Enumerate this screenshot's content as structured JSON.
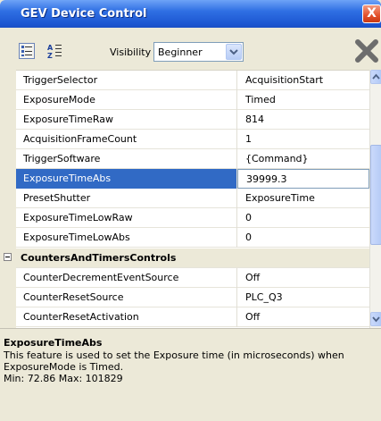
{
  "window": {
    "title": "GEV Device Control",
    "close_glyph": "X"
  },
  "toolbar": {
    "categorized_view_icon": "categorized-view-icon",
    "sort_alpha_icon": "sort-az-icon",
    "visibility_label": "Visibility",
    "visibility_value": "Beginner",
    "delete_icon": "x-icon"
  },
  "grid": {
    "rows": [
      {
        "name": "TriggerSelector",
        "value": "AcquisitionStart"
      },
      {
        "name": "ExposureMode",
        "value": "Timed"
      },
      {
        "name": "ExposureTimeRaw",
        "value": "814"
      },
      {
        "name": "AcquisitionFrameCount",
        "value": "1"
      },
      {
        "name": "TriggerSoftware",
        "value": "{Command}"
      },
      {
        "name": "ExposureTimeAbs",
        "value": "39999.3"
      },
      {
        "name": "PresetShutter",
        "value": "ExposureTime"
      },
      {
        "name": "ExposureTimeLowRaw",
        "value": "0"
      },
      {
        "name": "ExposureTimeLowAbs",
        "value": "0"
      }
    ],
    "category": {
      "label": "CountersAndTimersControls",
      "toggle": "−"
    },
    "category_rows": [
      {
        "name": "CounterDecrementEventSource",
        "value": "Off"
      },
      {
        "name": "CounterResetSource",
        "value": "PLC_Q3"
      },
      {
        "name": "CounterResetActivation",
        "value": "Off"
      }
    ],
    "selected_row": "ExposureTimeAbs"
  },
  "description": {
    "title": "ExposureTimeAbs",
    "text": "This feature is used to set the Exposure time (in microseconds) when ExposureMode is Timed.",
    "minmax": "Min: 72.86 Max: 101829"
  },
  "colors": {
    "title_bar": "#2f6fe3",
    "selection": "#316ac5",
    "panel": "#ece9d8"
  }
}
